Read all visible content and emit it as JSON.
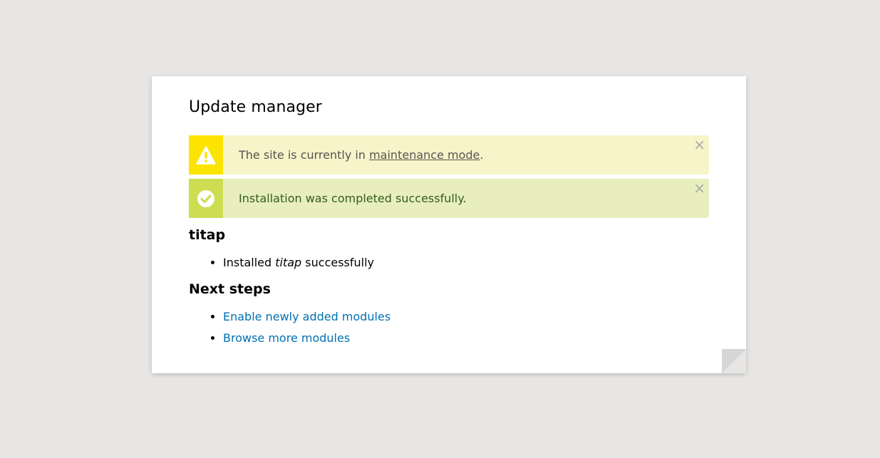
{
  "page": {
    "title": "Update manager"
  },
  "messages": {
    "warning": {
      "icon": "warning-icon",
      "prefix": "The site is currently in ",
      "link_label": "maintenance mode",
      "suffix": ".",
      "close_label": "×"
    },
    "status": {
      "icon": "check-circle-icon",
      "text": "Installation was completed successfully.",
      "close_label": "×"
    }
  },
  "project": {
    "heading": "titap",
    "items": [
      {
        "prefix": "Installed ",
        "name": "titap",
        "suffix": " successfully"
      }
    ]
  },
  "next_steps": {
    "heading": "Next steps",
    "links": [
      "Enable newly added modules",
      "Browse more modules"
    ]
  },
  "colors": {
    "background": "#e7e6e4",
    "warning_bg": "#f7f4ca",
    "warning_accent": "#fde400",
    "status_bg": "#e8eebe",
    "status_accent": "#cddd52",
    "link": "#0071b3"
  }
}
